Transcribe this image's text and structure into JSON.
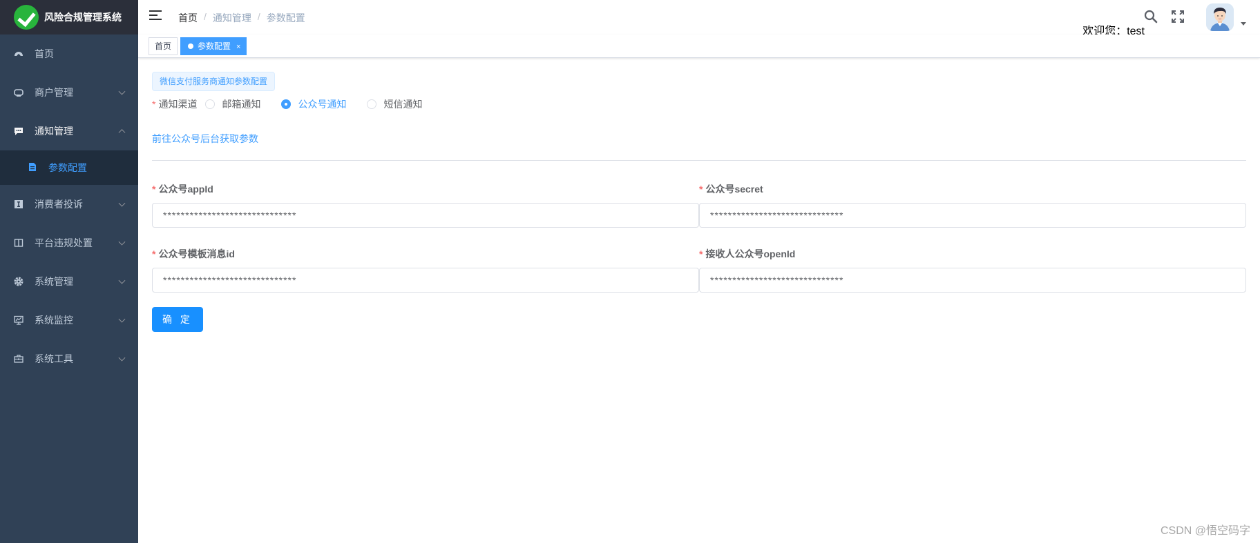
{
  "app": {
    "title": "风险合规管理系统"
  },
  "sidebar": {
    "items": [
      {
        "label": "首页",
        "icon": "dashboard-icon"
      },
      {
        "label": "商户管理",
        "icon": "merchant-icon"
      },
      {
        "label": "通知管理",
        "icon": "message-icon"
      },
      {
        "label": "参数配置",
        "icon": "document-icon"
      },
      {
        "label": "消费者投诉",
        "icon": "complaint-icon"
      },
      {
        "label": "平台违规处置",
        "icon": "violation-icon"
      },
      {
        "label": "系统管理",
        "icon": "gear-icon"
      },
      {
        "label": "系统监控",
        "icon": "monitor-icon"
      },
      {
        "label": "系统工具",
        "icon": "toolbox-icon"
      }
    ]
  },
  "navbar": {
    "breadcrumb": [
      "首页",
      "通知管理",
      "参数配置"
    ],
    "separator": "/",
    "welcome": "欢迎您：test"
  },
  "tags": {
    "home": "首页",
    "active": "参数配置",
    "close": "×"
  },
  "form": {
    "section_tag": "微信支付服务商通知参数配置",
    "channel_label": "通知渠道",
    "required_mark": "*",
    "channels": [
      "邮箱通知",
      "公众号通知",
      "短信通知"
    ],
    "selected_channel": "公众号通知",
    "link_text": "前往公众号后台获取参数",
    "fields": [
      {
        "label": "公众号appId",
        "value": "******************************"
      },
      {
        "label": "公众号secret",
        "value": "******************************"
      },
      {
        "label": "公众号模板消息id",
        "value": "******************************"
      },
      {
        "label": "接收人公众号openId",
        "value": "******************************"
      }
    ],
    "confirm_label": "确 定"
  },
  "watermark": "CSDN @悟空码字",
  "colors": {
    "sidebar_bg": "#304156",
    "accent": "#409eff",
    "primary_button": "#1890ff",
    "required": "#f56c6c"
  }
}
